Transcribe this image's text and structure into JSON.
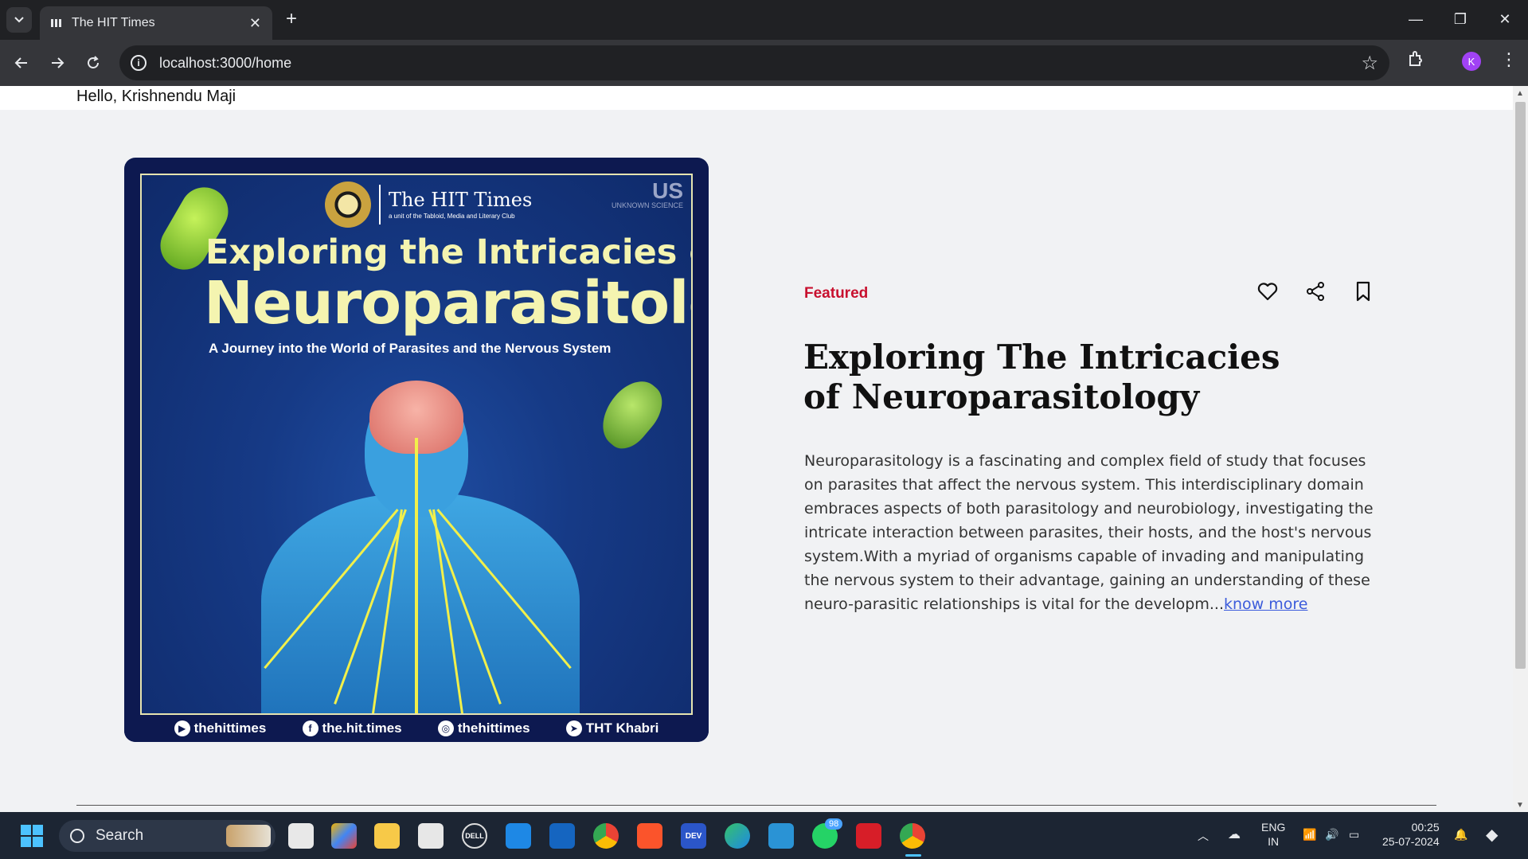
{
  "browser": {
    "tab_title": "The HIT Times",
    "url": "localhost:3000/home",
    "profile_initial": "K"
  },
  "page": {
    "greeting": "Hello, Krishnendu Maji",
    "poster": {
      "brand_name": "The HIT Times",
      "brand_sub": "a unit of the Tabloid, Media and Literary Club",
      "corner_logo": "US",
      "corner_sub": "UNKNOWN SCIENCE",
      "line1": "Exploring the Intricacies of",
      "line2": "Neuroparasitology",
      "line3": "A Journey into the World of Parasites and the Nervous System",
      "socials": [
        {
          "icon": "youtube-icon",
          "label": "thehittimes"
        },
        {
          "icon": "facebook-icon",
          "label": "the.hit.times"
        },
        {
          "icon": "instagram-icon",
          "label": "thehittimes"
        },
        {
          "icon": "play-icon",
          "label": "THT Khabri"
        }
      ]
    },
    "article": {
      "tag": "Featured",
      "title": "Exploring The Intricacies of Neuroparasitology",
      "excerpt": "Neuroparasitology is a fascinating and complex field of study that focuses on parasites that affect the nervous system. This interdisciplinary domain embraces aspects of both parasitology and neurobiology, investigating the intricate interaction between parasites, their hosts, and the host's nervous system.With a myriad of organisms capable of invading and manipulating the nervous system to their advantage, gaining an understanding of these neuro-parasitic relationships is vital for the developm...",
      "link": "know more"
    }
  },
  "taskbar": {
    "search_placeholder": "Search",
    "whatsapp_badge": "98",
    "lang_line1": "ENG",
    "lang_line2": "IN",
    "time": "00:25",
    "date": "25-07-2024"
  },
  "colors": {
    "featured": "#c8102e",
    "link": "#3b5bdb",
    "poster_bg": "#0d1950"
  }
}
